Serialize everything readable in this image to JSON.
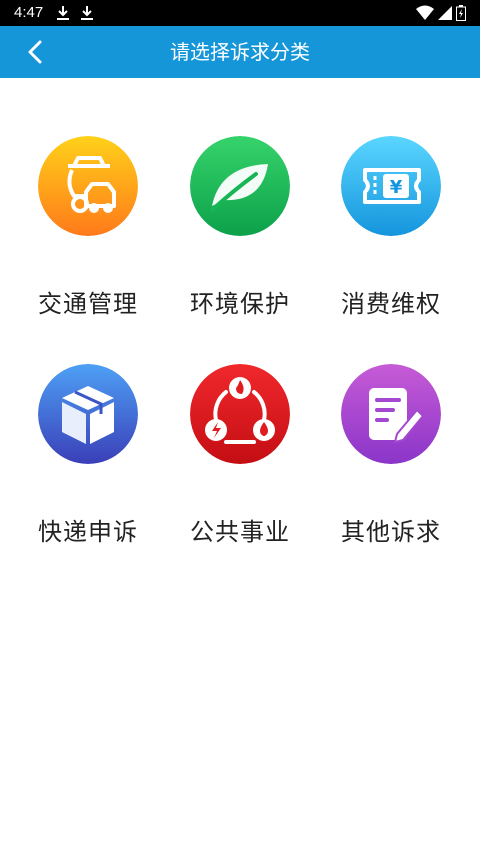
{
  "status_bar": {
    "time": "4:47",
    "icons": [
      "download-icon",
      "download-icon",
      "wifi-icon",
      "signal-icon",
      "battery-icon"
    ]
  },
  "app_bar": {
    "back_icon": "chevron-left-icon",
    "title": "请选择诉求分类",
    "color": "#1596d8"
  },
  "categories": [
    {
      "label": "交通管理",
      "icon": "traffic-management-icon",
      "gradient": [
        "#ffd11a",
        "#ff7a1a"
      ]
    },
    {
      "label": "环境保护",
      "icon": "leaf-icon",
      "gradient": [
        "#36d36b",
        "#0ca14a"
      ]
    },
    {
      "label": "消费维权",
      "icon": "coupon-yen-icon",
      "gradient": [
        "#5ad6ff",
        "#1595dd"
      ]
    },
    {
      "label": "快递申诉",
      "icon": "package-box-icon",
      "gradient": [
        "#4ea0f5",
        "#3a3fb8"
      ]
    },
    {
      "label": "公共事业",
      "icon": "utilities-cycle-icon",
      "gradient": [
        "#f0282c",
        "#c40e14"
      ]
    },
    {
      "label": "其他诉求",
      "icon": "note-pencil-icon",
      "gradient": [
        "#c65bd6",
        "#8b35c9"
      ]
    }
  ]
}
